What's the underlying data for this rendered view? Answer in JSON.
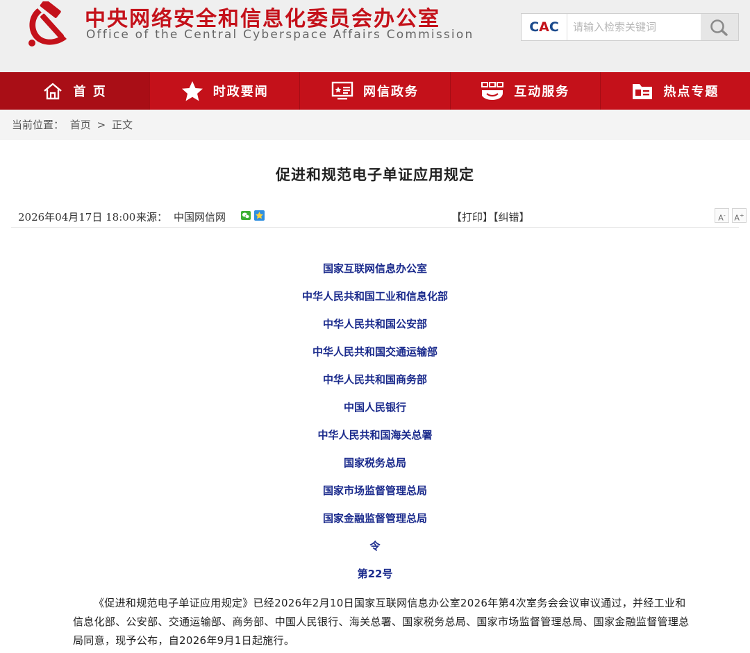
{
  "header": {
    "title": "中央网络安全和信息化委员会办公室",
    "subtitle": "Office of the Central Cyberspace Affairs Commission",
    "search_brand_a": "C",
    "search_brand_b": "A",
    "search_brand_c": "C",
    "search_placeholder": "请输入检索关键词",
    "colors": {
      "brand_red": "#c4111a",
      "nav_red": "#c4111a",
      "issuer_blue": "#1a2a8c"
    }
  },
  "nav": {
    "items": [
      {
        "label": "首 页",
        "icon": "home-icon"
      },
      {
        "label": "时政要闻",
        "icon": "star-icon"
      },
      {
        "label": "网信政务",
        "icon": "monitor-icon"
      },
      {
        "label": "互动服务",
        "icon": "interaction-icon"
      },
      {
        "label": "热点专题",
        "icon": "folder-icon"
      }
    ]
  },
  "breadcrumb": {
    "label": "当前位置：",
    "home": "首页",
    "sep": ">",
    "current": "正文"
  },
  "article": {
    "title": "促进和规范电子单证应用规定",
    "date": "2026年04月17日 18:00",
    "source_label": "来源：",
    "source": "中国网信网",
    "print": "【打印】",
    "correct": "【纠错】",
    "font_smaller": "A",
    "font_larger": "A",
    "issuers": [
      "国家互联网信息办公室",
      "中华人民共和国工业和信息化部",
      "中华人民共和国公安部",
      "中华人民共和国交通运输部",
      "中华人民共和国商务部",
      "中国人民银行",
      "中华人民共和国海关总署",
      "国家税务总局",
      "国家市场监督管理总局",
      "国家金融监督管理总局",
      "令",
      "第22号"
    ],
    "body": "《促进和规范电子单证应用规定》已经2026年2月10日国家互联网信息办公室2026年第4次室务会会议审议通过，并经工业和信息化部、公安部、交通运输部、商务部、中国人民银行、海关总署、国家税务总局、国家市场监督管理总局、国家金融监督管理总局同意，现予公布，自2026年9月1日起施行。"
  }
}
